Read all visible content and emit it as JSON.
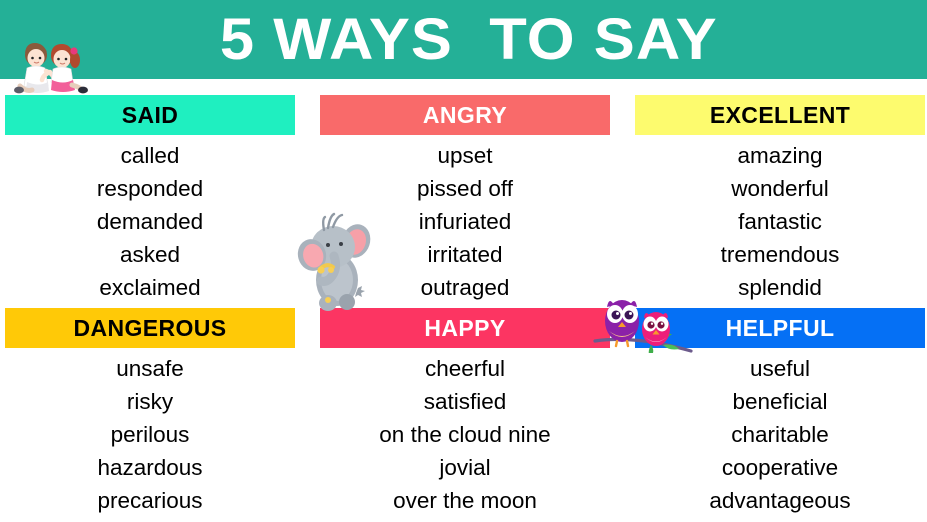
{
  "banner": {
    "title": "5 WAYS  TO SAY",
    "background_color": "#24B097",
    "text_color": "#FFFFFF"
  },
  "categories": [
    {
      "name": "SAID",
      "bar_color": "#1FEFC0",
      "label_color": "#000000",
      "column": 1,
      "row": 1,
      "words": [
        "called",
        "responded",
        "demanded",
        "asked",
        "exclaimed"
      ]
    },
    {
      "name": "ANGRY",
      "bar_color": "#F96A6A",
      "label_color": "#FFFFFF",
      "column": 2,
      "row": 1,
      "words": [
        "upset",
        "pissed off",
        "infuriated",
        "irritated",
        "outraged"
      ]
    },
    {
      "name": "EXCELLENT",
      "bar_color": "#FDFB6E",
      "label_color": "#000000",
      "column": 3,
      "row": 1,
      "words": [
        "amazing",
        "wonderful",
        "fantastic",
        "tremendous",
        "splendid"
      ]
    },
    {
      "name": "DANGEROUS",
      "bar_color": "#FFC907",
      "label_color": "#000000",
      "column": 1,
      "row": 2,
      "words": [
        "unsafe",
        "risky",
        "perilous",
        "hazardous",
        "precarious"
      ]
    },
    {
      "name": "HAPPY",
      "bar_color": "#FC3562",
      "label_color": "#FFFFFF",
      "column": 2,
      "row": 2,
      "words": [
        "cheerful",
        "satisfied",
        "on the cloud nine",
        "jovial",
        "over the moon"
      ]
    },
    {
      "name": "HELPFUL",
      "bar_color": "#0570F5",
      "label_color": "#FFFFFF",
      "column": 3,
      "row": 2,
      "words": [
        "useful",
        "beneficial",
        "charitable",
        "cooperative",
        "advantageous"
      ]
    }
  ],
  "illustrations": [
    {
      "name": "two-children-sitting",
      "position": "top-left"
    },
    {
      "name": "cartoon-elephant",
      "position": "middle-left"
    },
    {
      "name": "two-owls-on-branch",
      "position": "middle-right"
    }
  ]
}
